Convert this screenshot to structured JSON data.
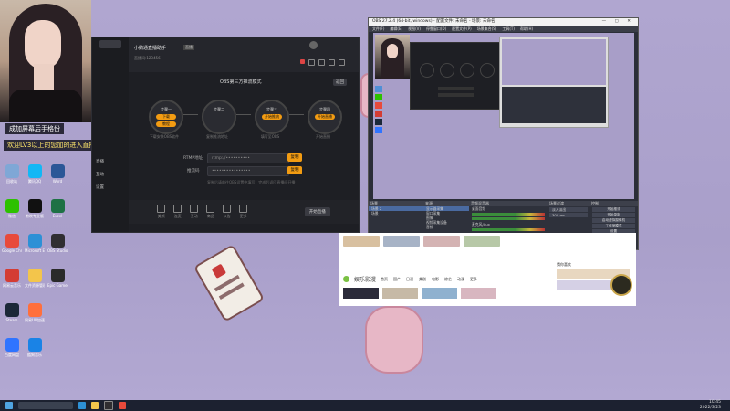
{
  "webcam": {
    "overlay_line1": "成加屏幕后手格份",
    "overlay_line2": "欢迎LV3以上的您加的进入直播间"
  },
  "desktop_icons": [
    {
      "label": "回收站",
      "color": "#7fa7d6"
    },
    {
      "label": "微信",
      "color": "#2dc100"
    },
    {
      "label": "Google Chrome",
      "color": "#e84a3b"
    },
    {
      "label": "网易云音乐",
      "color": "#d43c33"
    },
    {
      "label": "Steam",
      "color": "#1b2838"
    },
    {
      "label": "百度网盘",
      "color": "#2f74ff"
    },
    {
      "label": "腾讯QQ",
      "color": "#12b7f5"
    },
    {
      "label": "剪映专业版",
      "color": "#111111"
    },
    {
      "label": "Microsoft Edge",
      "color": "#2d90d6"
    },
    {
      "label": "文件资源管理器",
      "color": "#f3c54b"
    },
    {
      "label": "网易UU加速器",
      "color": "#ff6f3c"
    },
    {
      "label": "酷狗音乐",
      "color": "#1a83e6"
    },
    {
      "label": "Word",
      "color": "#2b5797"
    },
    {
      "label": "Excel",
      "color": "#1e7145"
    },
    {
      "label": "OBS Studio",
      "color": "#302e31"
    },
    {
      "label": "Epic Games",
      "color": "#2a2a2a"
    }
  ],
  "stream_app": {
    "title": "小鹅通直播助手",
    "title_badge": "直播",
    "room_line": "直播间:123456",
    "dialog_title": "OBS第三方推流模式",
    "back_button": "返回",
    "steps": [
      {
        "heading": "步骤一",
        "desc": "下载安装OBS软件",
        "buttons": [
          "下载",
          "教程"
        ]
      },
      {
        "heading": "步骤二",
        "desc": "复制推流地址",
        "buttons": []
      },
      {
        "heading": "步骤三",
        "desc": "填写至OBS",
        "buttons": [
          "开始推流"
        ]
      },
      {
        "heading": "步骤四",
        "desc": "开始直播",
        "buttons": [
          "开始直播"
        ]
      }
    ],
    "rtmp_label": "RTMP地址",
    "rtmp_value": "rtmp://••••••••••",
    "key_label": "推流码",
    "key_value": "••••••••••••••••",
    "copy_label": "复制",
    "hint": "复制后请前往OBS设置中填写，完成后返回直播间开播",
    "footer_items": [
      "美颜",
      "连麦",
      "互动",
      "商品",
      "公告",
      "更多"
    ],
    "start_button": "开始直播",
    "sidebar_items": [
      "直播",
      "互动",
      "设置"
    ],
    "accent": "#f39c12"
  },
  "obs": {
    "window_title": "OBS 27.2.4 (64-bit, windows) - 配置文件: 未命名 - 场景: 未命名",
    "menu": [
      "文件(F)",
      "编辑(E)",
      "视图(V)",
      "停靠窗口(D)",
      "配置文件(P)",
      "场景集合(S)",
      "工具(T)",
      "帮助(H)"
    ],
    "docks": {
      "scenes": {
        "title": "场景",
        "items": [
          "场景 2",
          "场景"
        ]
      },
      "sources": {
        "title": "来源",
        "items": [
          "显示器采集",
          "窗口采集",
          "图像",
          "视频采集设备",
          "音频"
        ]
      },
      "mixer": {
        "title": "音频混音器",
        "channels": [
          "桌面音频",
          "麦克风/Aux"
        ],
        "db": "0.0 dB"
      },
      "transitions": {
        "title": "场景过渡",
        "type": "淡入淡出",
        "duration": "300 ms"
      },
      "controls": {
        "title": "控制",
        "buttons": [
          "开始推流",
          "开始录制",
          "启动虚拟摄像机",
          "工作室模式",
          "设置",
          "退出"
        ]
      }
    },
    "status": "LIVE: 00:00:00  REC: 00:00:00  CPU: 3.1%, 30.00 fps"
  },
  "browser": {
    "site_title": "娱乐影漫",
    "nav": [
      "首页",
      "国产",
      "日漫",
      "美剧",
      "电影",
      "综艺",
      "动漫",
      "更多"
    ],
    "banner_label": "哔哩哔哩",
    "side_title": "猜你喜欢"
  },
  "taskbar": {
    "time": "10:45",
    "date": "2022/3/23"
  }
}
